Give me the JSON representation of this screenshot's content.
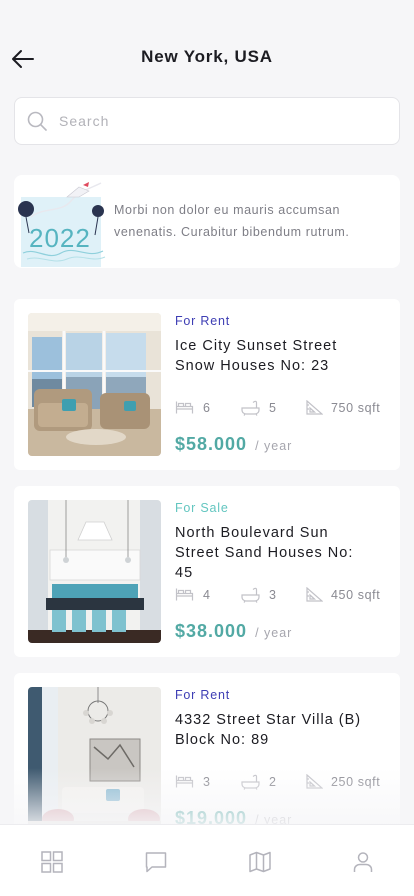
{
  "header": {
    "title": "New York, USA"
  },
  "search": {
    "placeholder": "Search",
    "value": ""
  },
  "promo": {
    "badge_text": "2022",
    "text": "Morbi non dolor eu mauris accumsan venenatis. Curabitur bibendum rutrum."
  },
  "listings": [
    {
      "tag": "For Rent",
      "name": "Ice City Sunset Street Snow Houses No: 23",
      "beds": "6",
      "baths": "5",
      "area": "750 sqft",
      "price": "$58.000",
      "period": "/ year"
    },
    {
      "tag": "For Sale",
      "name": "North Boulevard Sun Street Sand Houses No: 45",
      "beds": "4",
      "baths": "3",
      "area": "450 sqft",
      "price": "$38.000",
      "period": "/ year"
    },
    {
      "tag": "For Rent",
      "name": "4332 Street Star Villa (B) Block No: 89",
      "beds": "3",
      "baths": "2",
      "area": "250 sqft",
      "price": "$19.000",
      "period": "/ year"
    }
  ],
  "tabbar": {
    "items": [
      {
        "icon": "grid-icon"
      },
      {
        "icon": "chat-icon"
      },
      {
        "icon": "map-icon"
      },
      {
        "icon": "profile-icon"
      }
    ]
  },
  "colors": {
    "rent_tag": "#3e3eb4",
    "sale_tag": "#63c6c0",
    "price": "#52a9a4",
    "background": "#f6f6f8"
  }
}
